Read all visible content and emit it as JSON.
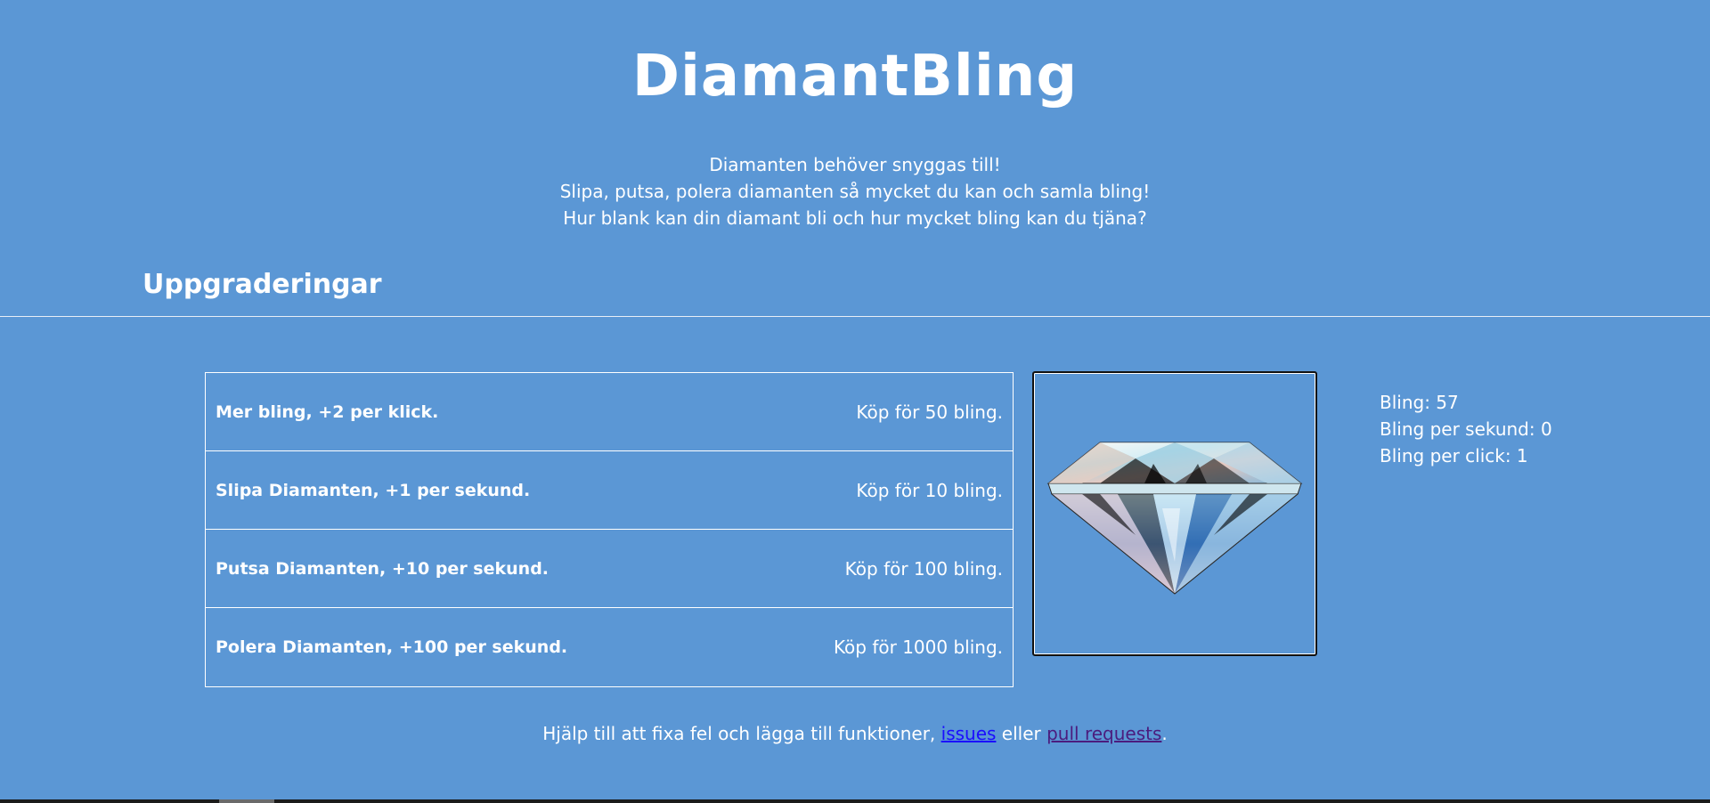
{
  "header": {
    "title": "DiamantBling",
    "intro": [
      "Diamanten behöver snyggas till!",
      "Slipa, putsa, polera diamanten så mycket du kan och samla bling!",
      "Hur blank kan din diamant bli och hur mycket bling kan du tjäna?"
    ]
  },
  "upgrades": {
    "heading": "Uppgraderingar",
    "items": [
      {
        "name": "Mer bling, +2 per klick.",
        "price": "Köp för 50 bling."
      },
      {
        "name": "Slipa Diamanten, +1 per sekund.",
        "price": "Köp för 10 bling."
      },
      {
        "name": "Putsa Diamanten, +10 per sekund.",
        "price": "Köp för 100 bling."
      },
      {
        "name": "Polera Diamanten, +100 per sekund.",
        "price": "Köp för 1000 bling."
      }
    ]
  },
  "stats": {
    "bling": "Bling: 57",
    "bling_per_second": "Bling per sekund: 0",
    "bling_per_click": "Bling per click: 1"
  },
  "footer": {
    "text_before": "Hjälp till att fixa fel och lägga till funktioner, ",
    "issues_label": "issues",
    "middle": " eller ",
    "pr_label": "pull requests",
    "text_after": "."
  },
  "colors": {
    "background": "#5b97d5",
    "text": "#ffffff",
    "issues_link": "#1a0dff",
    "pr_link": "#4b1c7e"
  },
  "icons": {
    "diamond": "diamond-icon"
  }
}
